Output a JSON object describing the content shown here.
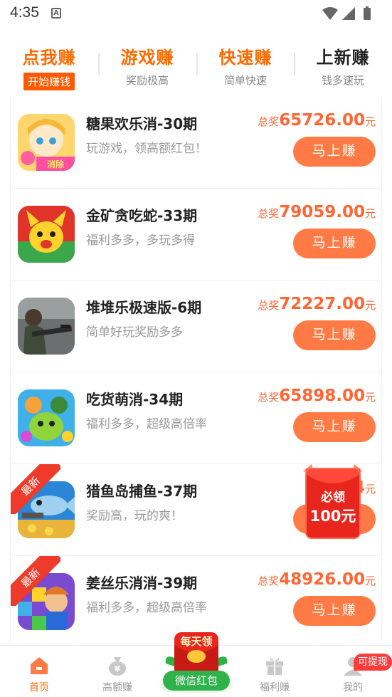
{
  "status_bar": {
    "time": "4:35",
    "notification_glyph": "A"
  },
  "tabs": [
    {
      "title": "点我赚",
      "subtitle": "开始赚钱"
    },
    {
      "title": "游戏赚",
      "subtitle": "奖励极高"
    },
    {
      "title": "快速赚",
      "subtitle": "简单快速"
    },
    {
      "title": "上新赚",
      "subtitle": "钱多速玩"
    }
  ],
  "list": {
    "prize_label": "总奖",
    "prize_unit": "元",
    "button_label": "马上赚",
    "new_badge": "最新",
    "items": [
      {
        "title": "糖果欢乐消-30期",
        "desc": "玩游戏，领高额红包！",
        "prize": "65726.00",
        "icon_badge": "消除"
      },
      {
        "title": "金矿贪吃蛇-33期",
        "desc": "福利多多，多玩多得",
        "prize": "79059.00"
      },
      {
        "title": "堆堆乐极速版-6期",
        "desc": "简单好玩奖励多多",
        "prize": "72227.00"
      },
      {
        "title": "吃货萌消-34期",
        "desc": "福利多多，超级高倍率",
        "prize": "65898.00"
      },
      {
        "title": "猎鱼岛捕鱼-37期",
        "desc": "奖励高，玩的爽！",
        "prize": "24"
      },
      {
        "title": "姜丝乐消消-39期",
        "desc": "福利多多，超级高倍率",
        "prize": "48926.00"
      }
    ]
  },
  "float_packet": {
    "line1": "必领",
    "line2": "100元"
  },
  "bottom_nav": {
    "items": [
      {
        "label": "首页",
        "icon": "home-icon"
      },
      {
        "label": "高额赚",
        "icon": "money-bag-icon"
      },
      {
        "label": "福利赚",
        "icon": "gift-icon"
      },
      {
        "label": "我的",
        "icon": "user-icon"
      }
    ],
    "center_top": "每天领",
    "center_label": "微信红包",
    "withdraw_badge": "可提现"
  },
  "colors": {
    "accent": "#ff6a00",
    "button": "#ff7a45",
    "prize": "#ff6633",
    "ribbon": "#ee3b2b",
    "wechat_green": "#2fb24a"
  }
}
